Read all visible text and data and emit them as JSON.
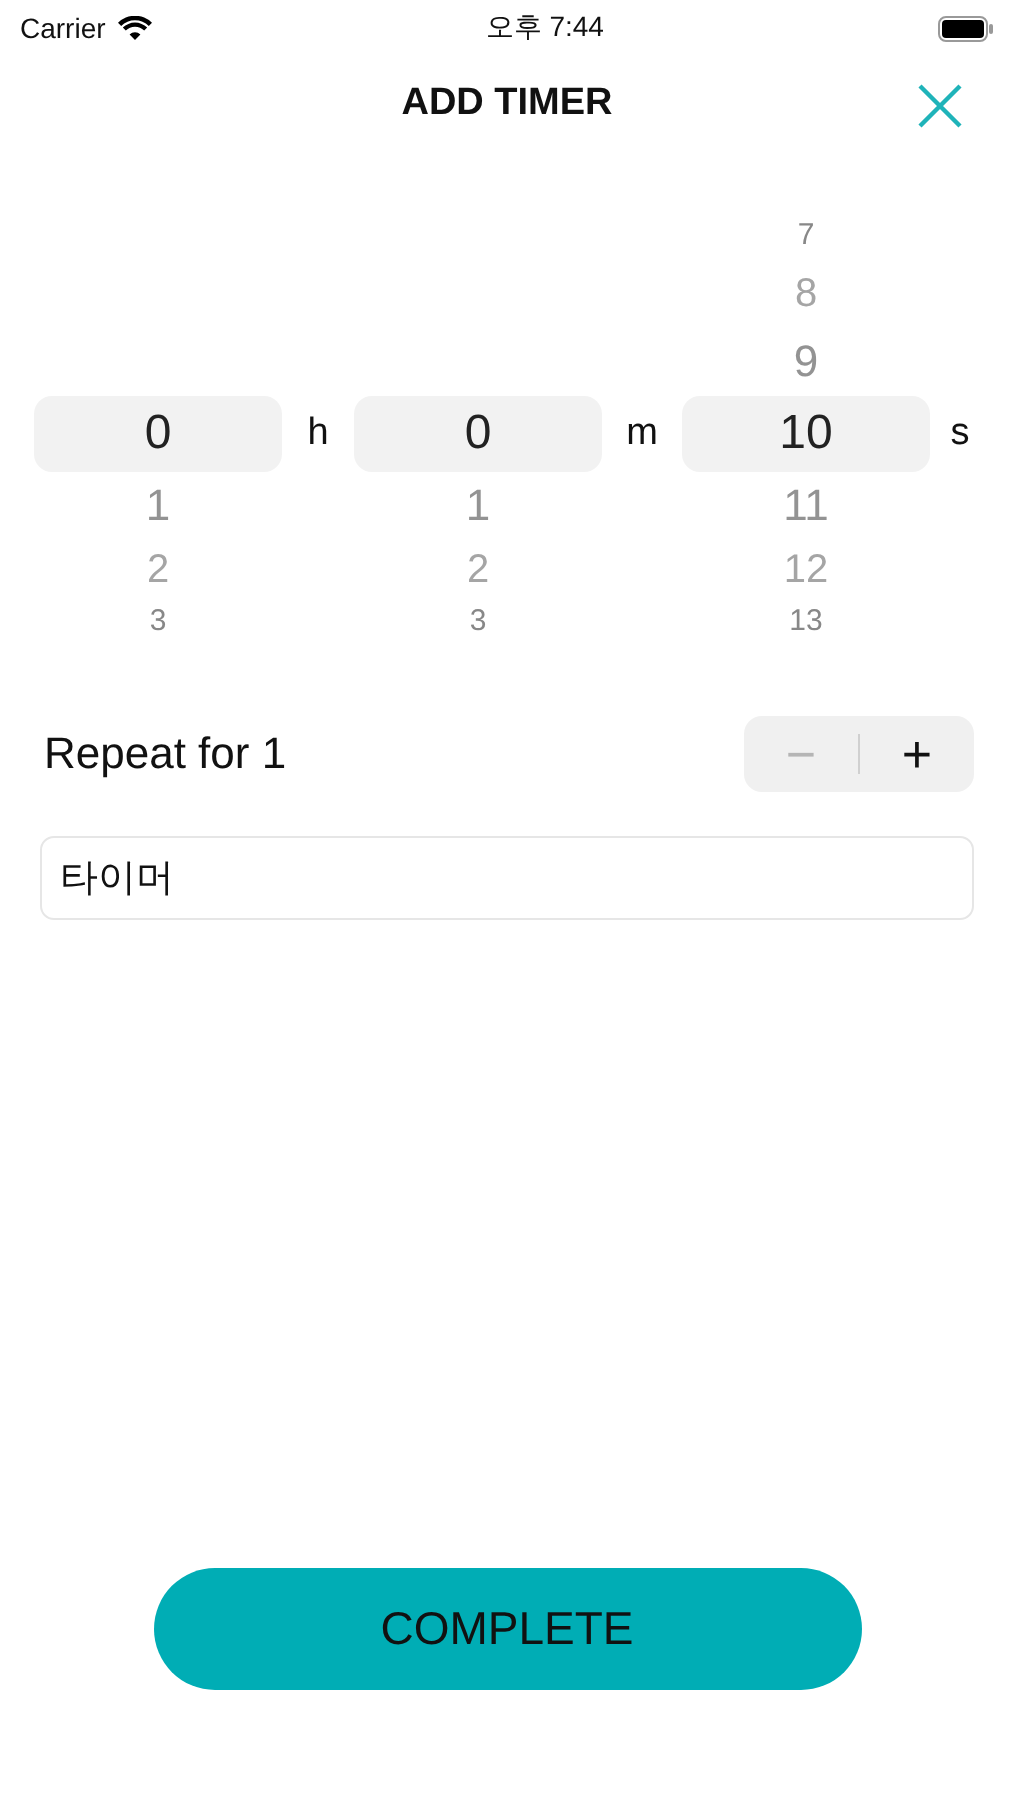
{
  "status_bar": {
    "carrier": "Carrier",
    "time": "오후 7:44"
  },
  "header": {
    "title": "ADD TIMER"
  },
  "picker": {
    "columns": [
      {
        "selected": "0",
        "below": [
          "1",
          "2",
          "3"
        ],
        "unit": "h"
      },
      {
        "selected": "0",
        "below": [
          "1",
          "2",
          "3"
        ],
        "unit": "m"
      },
      {
        "above": [
          "7",
          "8",
          "9"
        ],
        "selected": "10",
        "below": [
          "11",
          "12",
          "13"
        ],
        "unit": "s"
      }
    ]
  },
  "repeat": {
    "label": "Repeat for 1",
    "minus": {
      "label": "−",
      "disabled": true
    },
    "plus": {
      "label": "+",
      "disabled": false
    }
  },
  "name_field": {
    "value": "타이머"
  },
  "complete_button": {
    "label": "COMPLETE"
  }
}
